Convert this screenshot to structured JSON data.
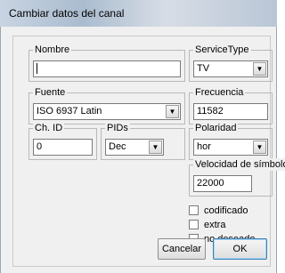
{
  "window": {
    "title": "Cambiar datos del canal"
  },
  "fields": {
    "nombre": {
      "label": "Nombre",
      "value": ""
    },
    "service_type": {
      "label": "ServiceType",
      "value": "TV"
    },
    "fuente": {
      "label": "Fuente",
      "value": "ISO 6937 Latin"
    },
    "frecuencia": {
      "label": "Frecuencia",
      "value": "11582"
    },
    "ch_id": {
      "label": "Ch. ID",
      "value": "0"
    },
    "pids": {
      "label": "PIDs",
      "value": "Dec"
    },
    "polaridad": {
      "label": "Polaridad",
      "value": "hor"
    },
    "velocidad": {
      "label": "Velocidad de símbolo",
      "value": "22000"
    }
  },
  "checkboxes": [
    {
      "label": "codificado",
      "checked": false
    },
    {
      "label": "extra",
      "checked": false
    },
    {
      "label": "no deseado",
      "checked": false
    }
  ],
  "buttons": {
    "cancel": "Cancelar",
    "ok": "OK"
  },
  "icons": {
    "dropdown": "chevron-down-icon"
  }
}
